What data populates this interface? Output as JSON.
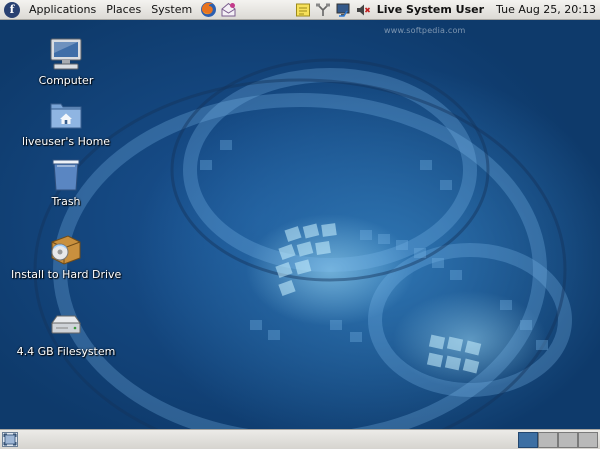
{
  "top_panel": {
    "logo_letter": "f",
    "menus": [
      "Applications",
      "Places",
      "System"
    ],
    "launchers": [
      {
        "name": "firefox-icon"
      },
      {
        "name": "mail-icon"
      }
    ],
    "tray_icons": [
      "notes-icon",
      "network-wired-icon",
      "display-icon",
      "volume-icon"
    ],
    "user_label": "Live System User",
    "clock_text": "Tue Aug 25, 20:13"
  },
  "desktop": {
    "watermark": "www.softpedia.com",
    "icons": [
      {
        "label": "Computer",
        "icon": "computer-icon"
      },
      {
        "label": "liveuser's Home",
        "icon": "home-folder-icon"
      },
      {
        "label": "Trash",
        "icon": "trash-icon"
      },
      {
        "label": "Install to Hard Drive",
        "icon": "install-icon"
      },
      {
        "label": "4.4 GB Filesystem",
        "icon": "drive-icon"
      }
    ]
  },
  "bottom_panel": {
    "workspace_count": 4,
    "active_workspace": 1
  },
  "colors": {
    "panel_bg": "#dcdad5",
    "desktop_bg": "#0e3a6b",
    "accent": "#3d6fa3"
  }
}
